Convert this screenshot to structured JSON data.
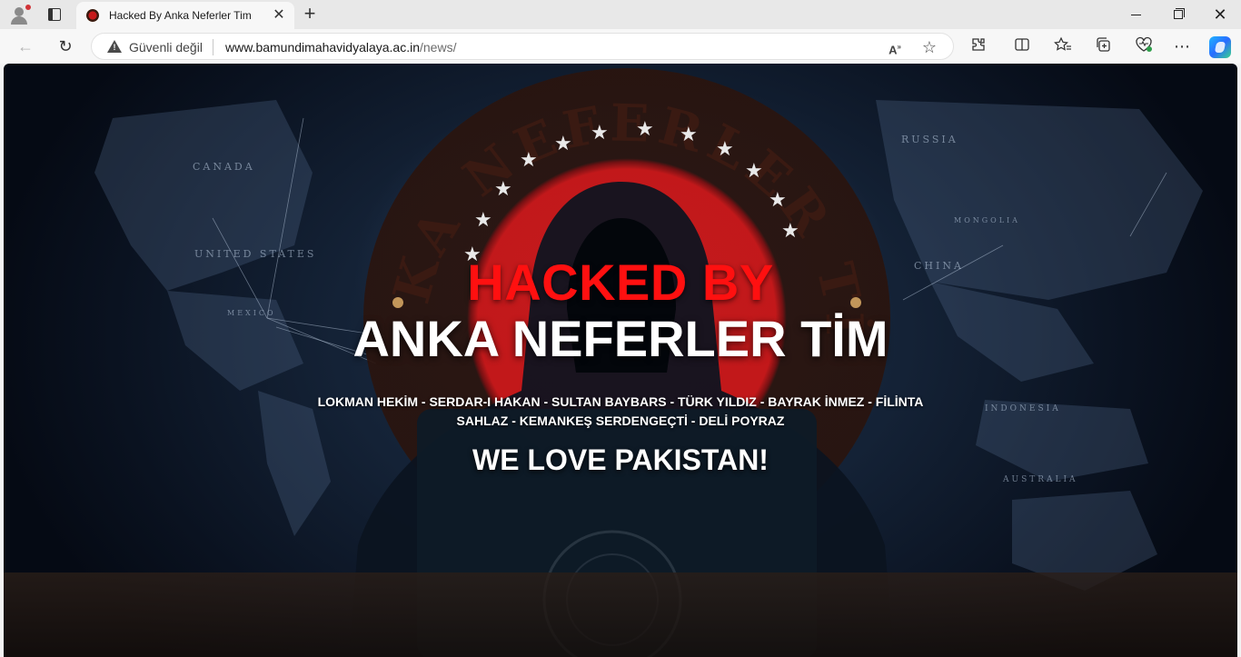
{
  "browser": {
    "tab_title": "Hacked By Anka Neferler Tim",
    "security_label": "Güvenli değil",
    "url_host": "www.bamundimahavidyalaya.ac.in",
    "url_path": "/news/",
    "icons": [
      "profile-icon",
      "tab-actions-icon",
      "favicon",
      "close-icon",
      "new-tab-icon",
      "back-icon",
      "reload-icon",
      "warning-icon",
      "read-aloud-icon",
      "favorite-star-icon",
      "extensions-icon",
      "split-screen-icon",
      "favorites-icon",
      "collections-icon",
      "browser-essentials-icon",
      "more-icon",
      "copilot-icon",
      "minimize-icon",
      "maximize-icon",
      "window-close-icon"
    ]
  },
  "page": {
    "headline": "HACKED BY",
    "team_name": "ANKA NEFERLER TİM",
    "members_line1": "LOKMAN HEKİM - SERDAR-I HAKAN - SULTAN BAYBARS - TÜRK YILDIZ - BAYRAK İNMEZ - FİLİNTA",
    "members_line2": "SAHLAZ - KEMANKEŞ SERDENGEÇTİ - DELİ POYRAZ",
    "message": "WE LOVE PAKISTAN!",
    "emblem_text": "ANKA NEFERLER TİM",
    "map_labels": [
      "CANADA",
      "UNITED STATES",
      "RUSSIA",
      "CHINA",
      "MEXICO",
      "INDONESIA",
      "AUSTRALIA",
      "MONGOLIA"
    ],
    "colors": {
      "headline": "#ff1010",
      "team": "#ffffff",
      "background": "#142236"
    }
  }
}
